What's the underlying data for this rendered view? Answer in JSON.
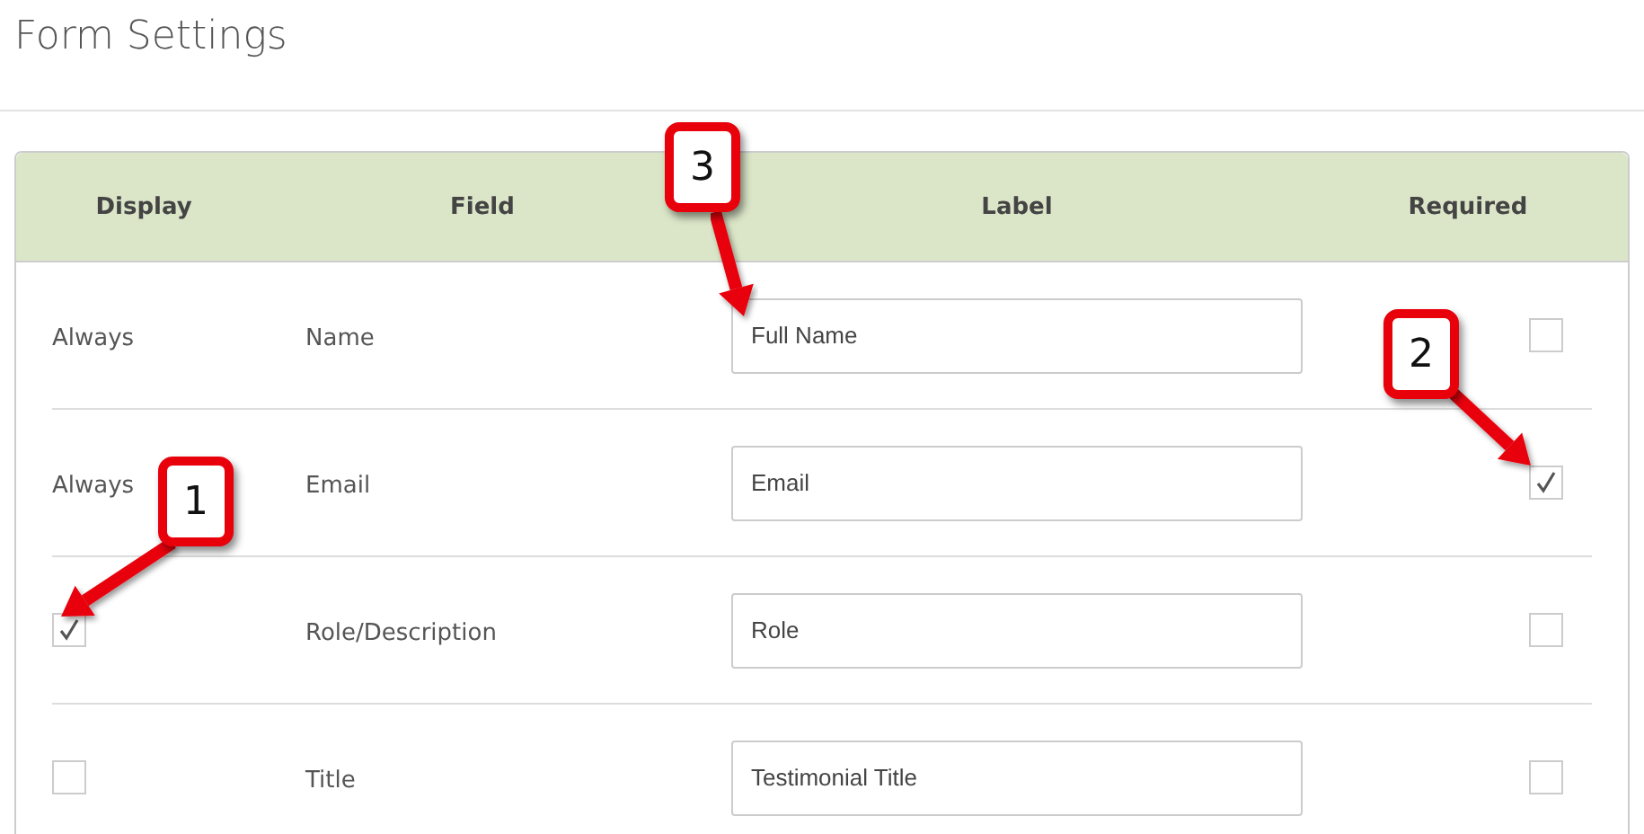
{
  "page": {
    "title": "Form Settings"
  },
  "table": {
    "columns": [
      "Display",
      "Field",
      "Label",
      "Required"
    ],
    "rows": [
      {
        "display": {
          "kind": "text",
          "text": "Always"
        },
        "field": "Name",
        "label": "Full Name",
        "required": false
      },
      {
        "display": {
          "kind": "text",
          "text": "Always"
        },
        "field": "Email",
        "label": "Email",
        "required": true
      },
      {
        "display": {
          "kind": "checkbox",
          "checked": true
        },
        "field": "Role/Description",
        "label": "Role",
        "required": false
      },
      {
        "display": {
          "kind": "checkbox",
          "checked": false
        },
        "field": "Title",
        "label": "Testimonial Title",
        "required": false
      }
    ]
  },
  "callouts": [
    {
      "label": "3"
    },
    {
      "label": "2"
    },
    {
      "label": "1"
    }
  ]
}
